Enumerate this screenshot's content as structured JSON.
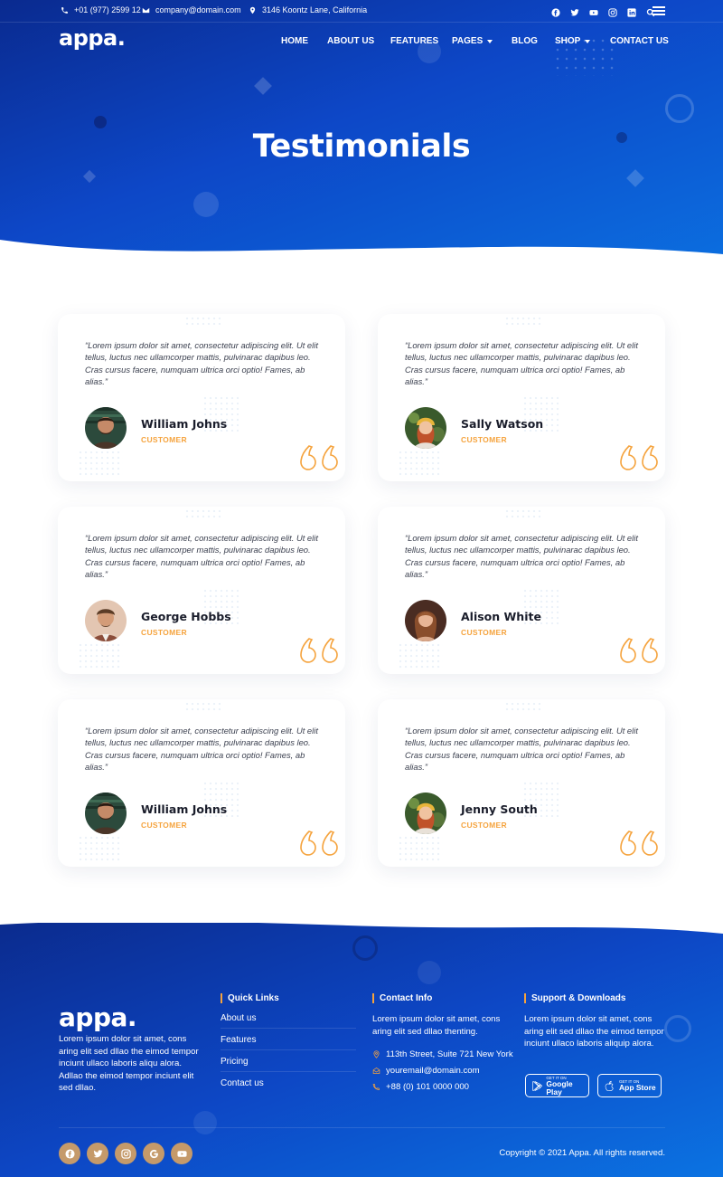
{
  "topbar": {
    "phone": "+01 (977) 2599 12",
    "email": "company@domain.com",
    "address": "3146 Koontz Lane, California",
    "social_icons": [
      "facebook-icon",
      "twitter-icon",
      "youtube-icon",
      "instagram-icon",
      "linkedin-icon",
      "search-icon"
    ]
  },
  "brand": {
    "logo": "appa."
  },
  "nav": {
    "items": [
      {
        "label": "HOME",
        "has_dropdown": false
      },
      {
        "label": "ABOUT US",
        "has_dropdown": false
      },
      {
        "label": "FEATURES",
        "has_dropdown": false
      },
      {
        "label": "PAGES",
        "has_dropdown": true
      },
      {
        "label": "BLOG",
        "has_dropdown": false
      },
      {
        "label": "SHOP",
        "has_dropdown": true
      },
      {
        "label": "CONTACT US",
        "has_dropdown": false
      }
    ]
  },
  "hero": {
    "title": "Testimonials"
  },
  "testimonials": [
    {
      "quote": "“Lorem ipsum dolor sit amet, consectetur adipiscing elit. Ut elit tellus, luctus nec ullamcorper mattis, pulvinarac dapibus leo. Cras cursus facere, numquam ultrica orci optio! Fames, ab alias.”",
      "name": "William Johns",
      "role": "CUSTOMER"
    },
    {
      "quote": "“Lorem ipsum dolor sit amet, consectetur adipiscing elit. Ut elit tellus, luctus nec ullamcorper mattis, pulvinarac dapibus leo. Cras cursus facere, numquam ultrica orci optio! Fames, ab alias.”",
      "name": "Sally Watson",
      "role": "CUSTOMER"
    },
    {
      "quote": "“Lorem ipsum dolor sit amet, consectetur adipiscing elit. Ut elit tellus, luctus nec ullamcorper mattis, pulvinarac dapibus leo. Cras cursus facere, numquam ultrica orci optio! Fames, ab alias.”",
      "name": "George Hobbs",
      "role": "CUSTOMER"
    },
    {
      "quote": "“Lorem ipsum dolor sit amet, consectetur adipiscing elit. Ut elit tellus, luctus nec ullamcorper mattis, pulvinarac dapibus leo. Cras cursus facere, numquam ultrica orci optio! Fames, ab alias.”",
      "name": "Alison White",
      "role": "CUSTOMER"
    },
    {
      "quote": "“Lorem ipsum dolor sit amet, consectetur adipiscing elit. Ut elit tellus, luctus nec ullamcorper mattis, pulvinarac dapibus leo. Cras cursus facere, numquam ultrica orci optio! Fames, ab alias.”",
      "name": "William Johns",
      "role": "CUSTOMER"
    },
    {
      "quote": "“Lorem ipsum dolor sit amet, consectetur adipiscing elit. Ut elit tellus, luctus nec ullamcorper mattis, pulvinarac dapibus leo. Cras cursus facere, numquam ultrica orci optio! Fames, ab alias.”",
      "name": "Jenny South",
      "role": "CUSTOMER"
    }
  ],
  "footer": {
    "logo": "appa.",
    "about": "Lorem ipsum dolor sit amet, cons aring elit sed dllao the eimod tempor inciunt ullaco laboris aliqu alora. Adllao the eimod tempor inciunt elit sed dllao.",
    "quick_links_title": "Quick Links",
    "quick_links": [
      "About us",
      "Features",
      "Pricing",
      "Contact us"
    ],
    "contact_title": "Contact Info",
    "contact_text": "Lorem ipsum dolor sit amet, cons aring elit sed dllao thenting.",
    "contact_address": "113th Street, Suite 721 New York",
    "contact_email": "youremail@domain.com",
    "contact_phone": "+88 (0) 101 0000 000",
    "support_title": "Support & Downloads",
    "support_text": "Lorem ipsum dolor sit amet, cons aring elit sed dllao the eimod tempor inciunt ullaco laboris aliquip alora.",
    "google_small": "GET IT ON",
    "google_big": "Google Play",
    "apple_small": "GET IT ON",
    "apple_big": "App Store",
    "social_icons": [
      "facebook-icon",
      "twitter-icon",
      "instagram-icon",
      "google-icon",
      "youtube-icon"
    ],
    "copyright": "Copyright © 2021 Appa. All rights reserved."
  },
  "colors": {
    "hero_gradient_start": "#0a2a8f",
    "hero_gradient_end": "#0b6fe0",
    "accent_orange": "#f5a33d",
    "social_circle": "#c59a6a",
    "text_dark": "#1a1d2b"
  }
}
